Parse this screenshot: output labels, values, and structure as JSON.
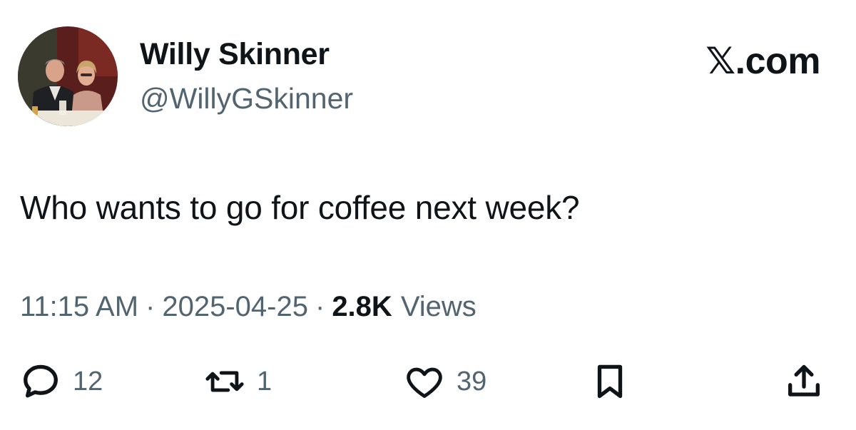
{
  "author": {
    "display_name": "Willy Skinner",
    "handle": "@WillyGSkinner",
    "avatar_icon": "profile-photo-couple"
  },
  "brand": "𝕏.com",
  "tweet": {
    "text": "Who wants to go for coffee next week?",
    "time": "11:15 AM",
    "date": "2025-04-25",
    "separator": "·",
    "views_count": "2.8K",
    "views_label": "Views"
  },
  "actions": {
    "reply": {
      "icon": "reply-icon",
      "count": "12"
    },
    "retweet": {
      "icon": "retweet-icon",
      "count": "1"
    },
    "like": {
      "icon": "heart-icon",
      "count": "39"
    },
    "bookmark": {
      "icon": "bookmark-icon"
    },
    "share": {
      "icon": "share-icon"
    }
  },
  "colors": {
    "text_primary": "#0f1419",
    "text_secondary": "#536471",
    "background": "#ffffff"
  }
}
